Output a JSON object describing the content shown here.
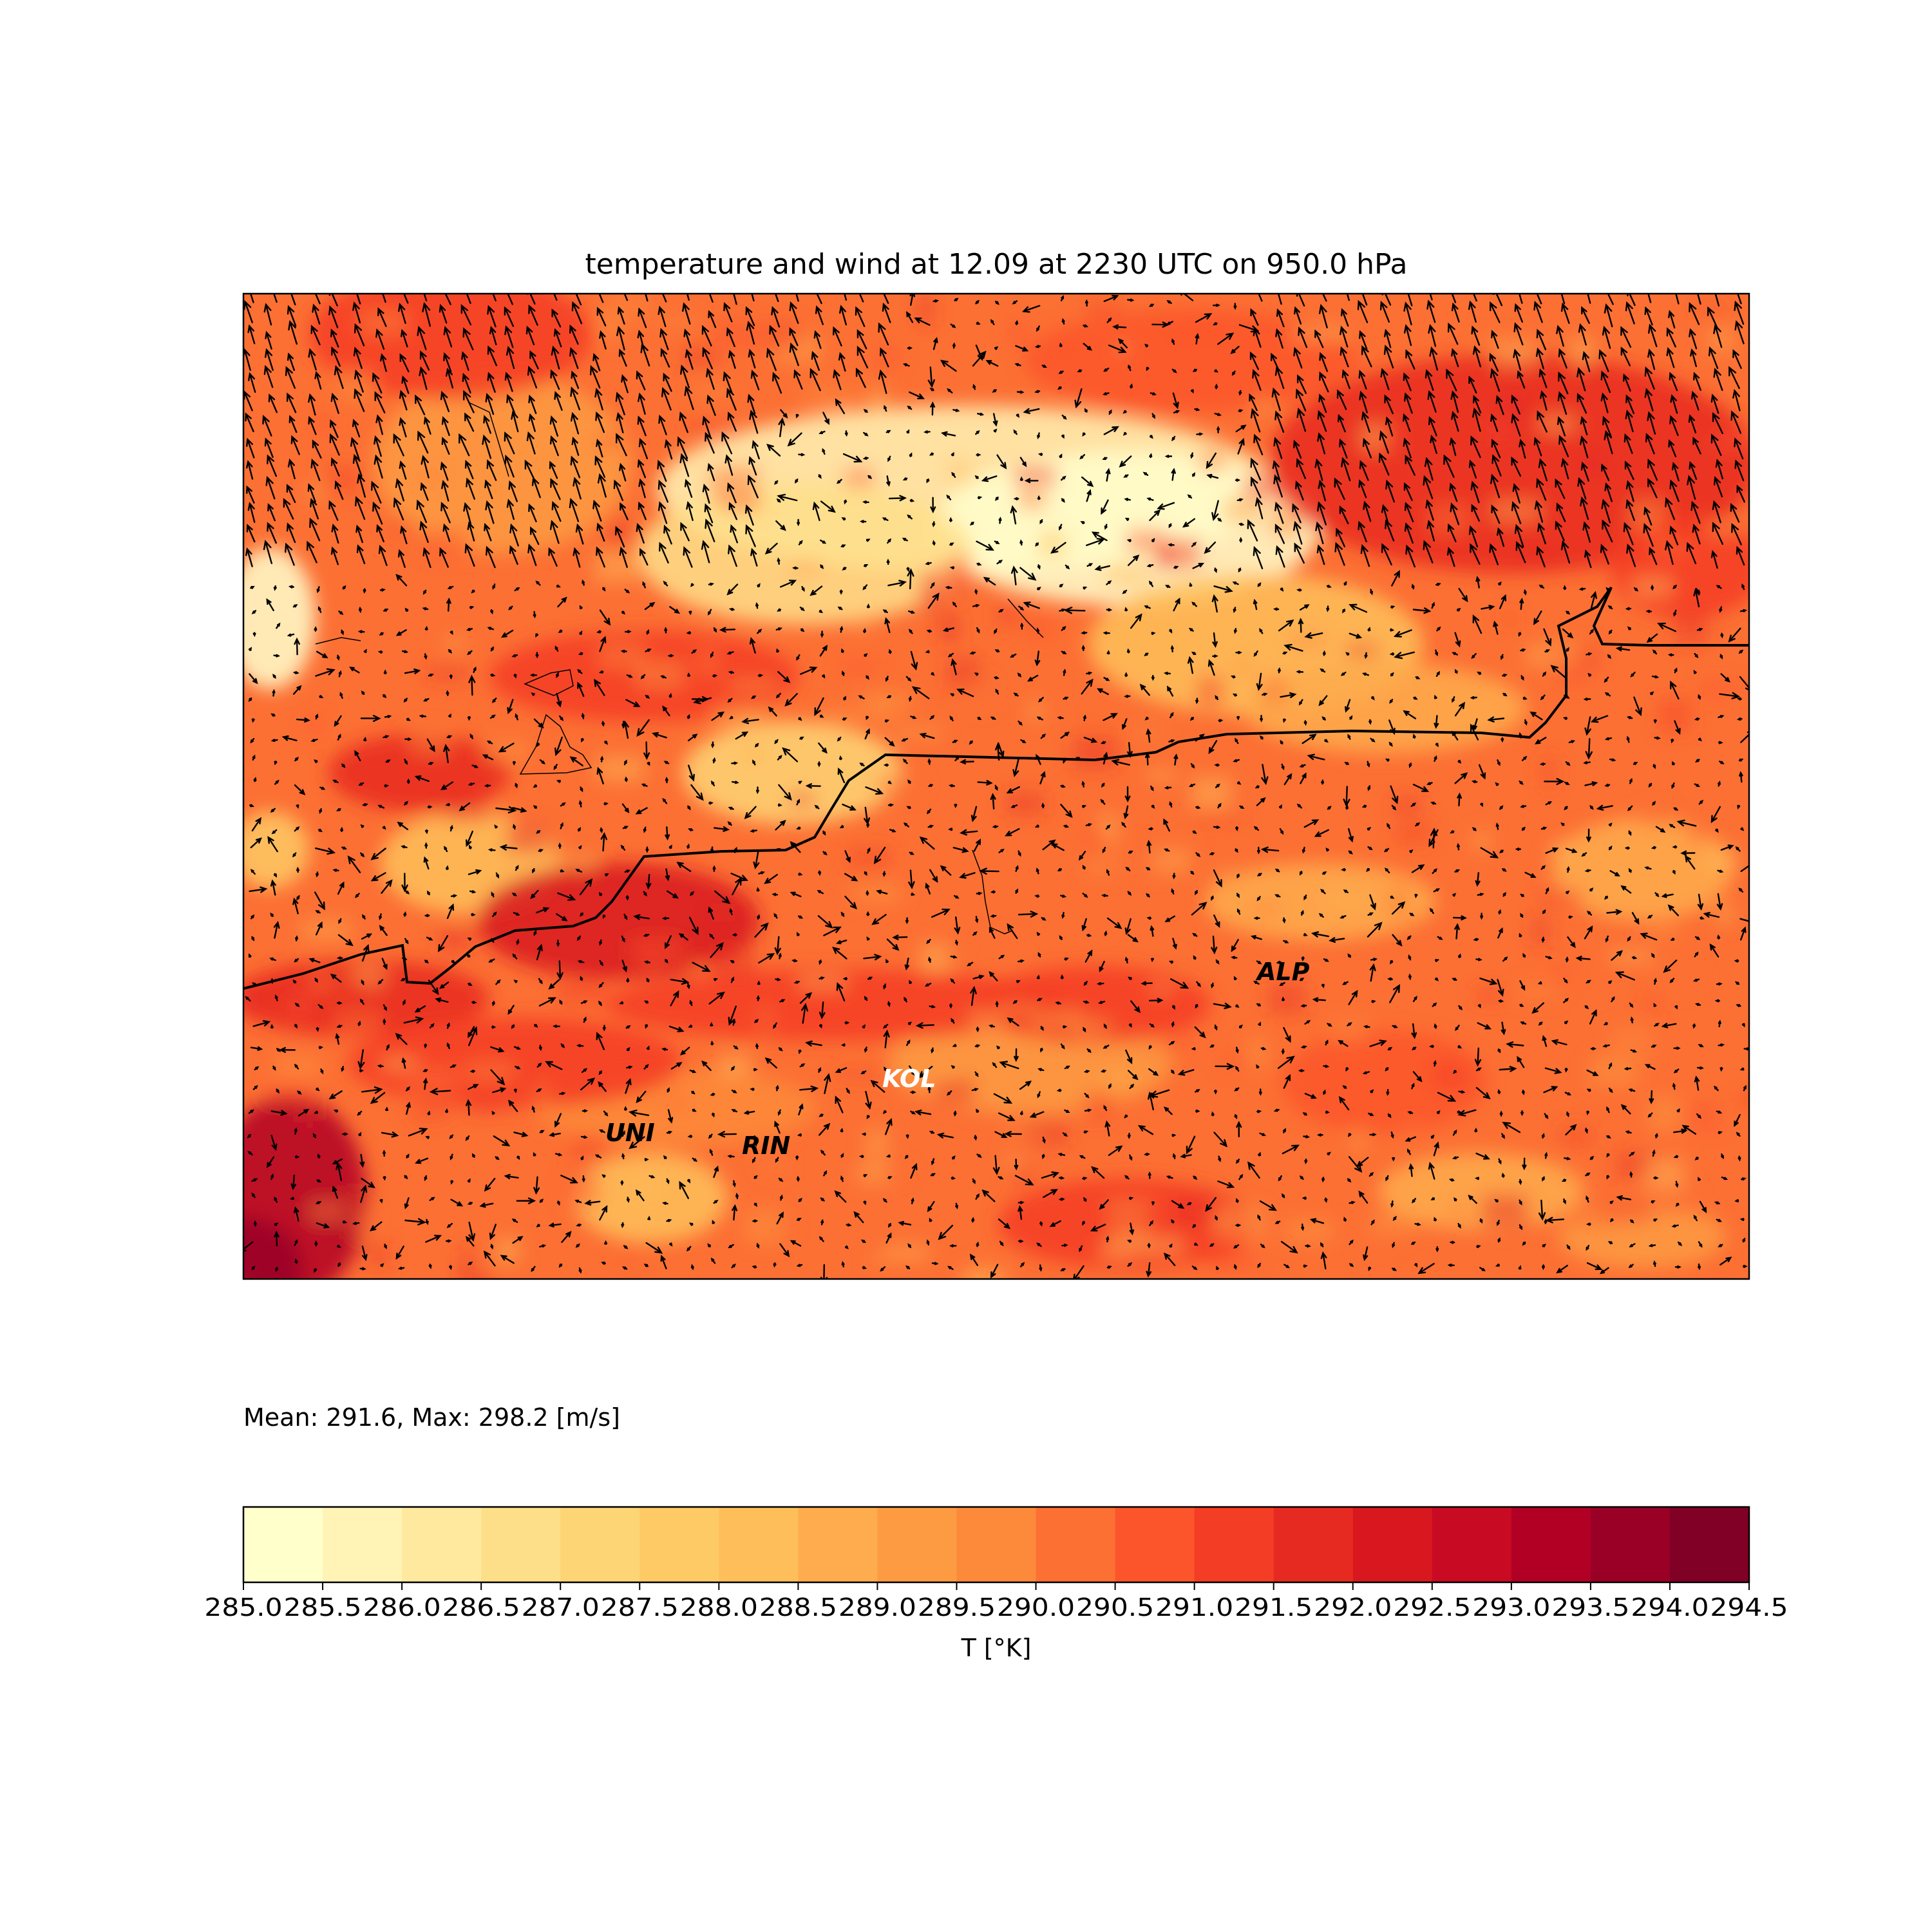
{
  "title": "temperature and wind at 12.09 at 2230 UTC on 950.0 hPa",
  "stats_text": "Mean: 291.6, Max: 298.2 [m/s]",
  "colorbar": {
    "label": "T [°K]",
    "levels": [
      285.0,
      285.5,
      286.0,
      286.5,
      287.0,
      287.5,
      288.0,
      288.5,
      289.0,
      289.5,
      290.0,
      290.5,
      291.0,
      291.5,
      292.0,
      292.5,
      293.0,
      293.5,
      294.0,
      294.5
    ],
    "tick_labels": [
      "285.0",
      "285.5",
      "286.0",
      "286.5",
      "287.0",
      "287.5",
      "288.0",
      "288.5",
      "289.0",
      "289.5",
      "290.0",
      "290.5",
      "291.0",
      "291.5",
      "292.0",
      "292.5",
      "293.0",
      "293.5",
      "294.0",
      "294.5"
    ],
    "colors": [
      "#ffffcc",
      "#fff4b5",
      "#ffe99e",
      "#fedf89",
      "#fed574",
      "#feca65",
      "#febf5a",
      "#feac4e",
      "#fd9b43",
      "#fd8a3b",
      "#fc7034",
      "#fc552c",
      "#f43d25",
      "#e72a21",
      "#d8181e",
      "#c80b22",
      "#b20025",
      "#9a0026",
      "#800026"
    ]
  },
  "map": {
    "stations": [
      {
        "label": "ALP",
        "color": "#111111"
      },
      {
        "label": "KOL",
        "color": "#ffffff"
      },
      {
        "label": "UNI",
        "color": "#111111"
      },
      {
        "label": "RIN",
        "color": "#111111"
      }
    ],
    "layers": [
      "temperature-field",
      "wind-vectors",
      "border-lines"
    ]
  }
}
